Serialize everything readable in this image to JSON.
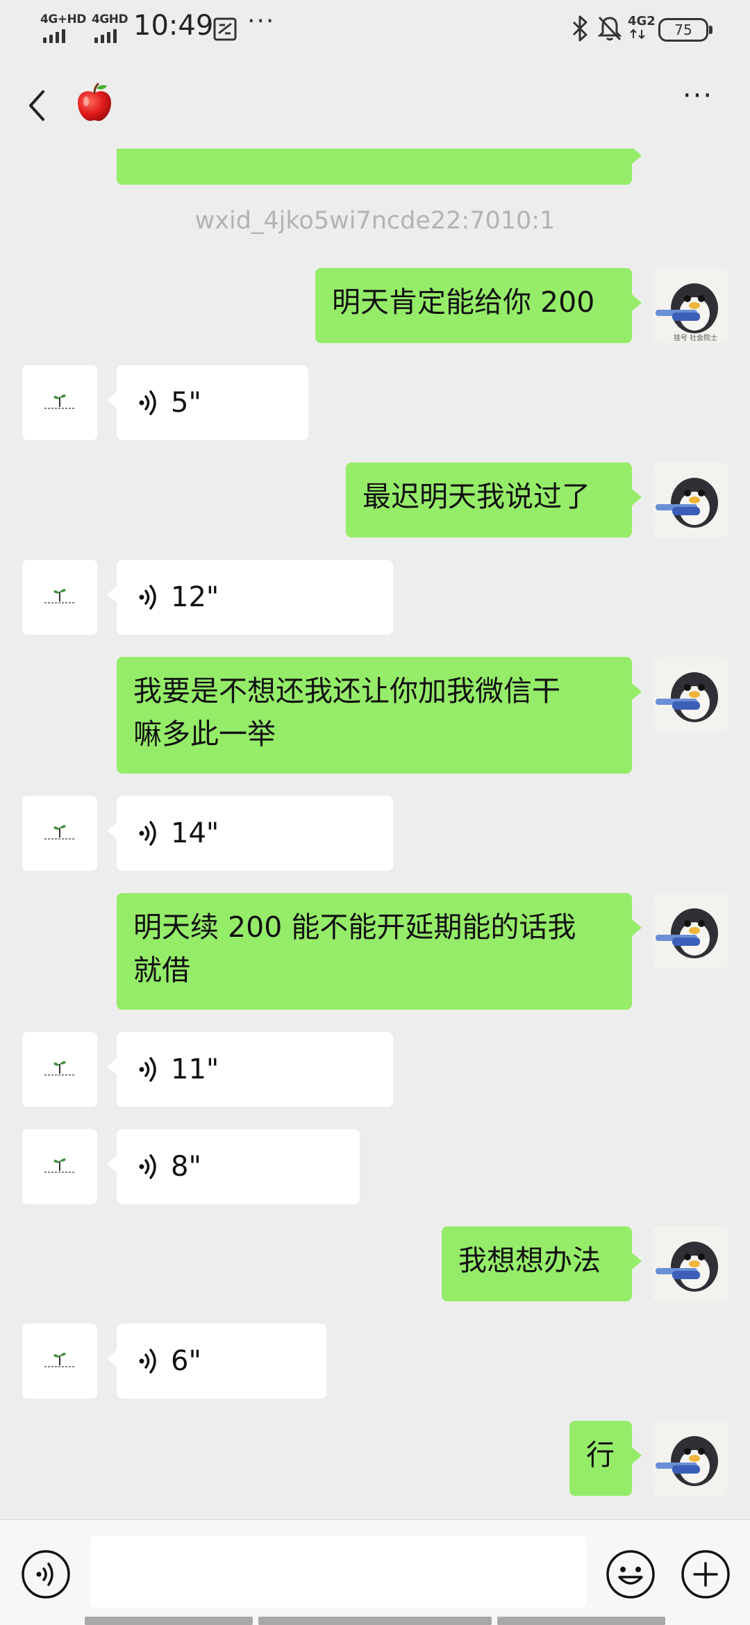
{
  "status_bar": {
    "network_1": "4G+HD",
    "network_2": "4GHD",
    "time": "10:49",
    "overflow": "···",
    "data_badge": "4G2",
    "battery": "75"
  },
  "header": {
    "title_icon": "apple-emoji",
    "more_label": "···"
  },
  "chat": {
    "system_notice": "wxid_4jko5wi7ncde22:7010:1",
    "messages": [
      {
        "dir": "out",
        "type": "text",
        "text": "明天肯定能给你 200"
      },
      {
        "dir": "in",
        "type": "voice",
        "duration": "5\""
      },
      {
        "dir": "out",
        "type": "text",
        "text": "最迟明天我说过了"
      },
      {
        "dir": "in",
        "type": "voice",
        "duration": "12\""
      },
      {
        "dir": "out",
        "type": "text",
        "line1": "我要是不想还我还让你加我微信干",
        "line2": "嘛多此一举"
      },
      {
        "dir": "in",
        "type": "voice",
        "duration": "14\""
      },
      {
        "dir": "out",
        "type": "text",
        "line1": "明天续 200 能不能开延期能的话我",
        "line2": "就借"
      },
      {
        "dir": "in",
        "type": "voice",
        "duration": "11\""
      },
      {
        "dir": "in",
        "type": "voice",
        "duration": "8\""
      },
      {
        "dir": "out",
        "type": "text",
        "text": "我想想办法"
      },
      {
        "dir": "in",
        "type": "voice",
        "duration": "6\""
      },
      {
        "dir": "out",
        "type": "text",
        "text": "行"
      }
    ]
  },
  "input": {
    "value": "",
    "placeholder": ""
  },
  "colors": {
    "outgoing_bubble": "#95ec69",
    "incoming_bubble": "#ffffff",
    "background": "#ededed"
  }
}
